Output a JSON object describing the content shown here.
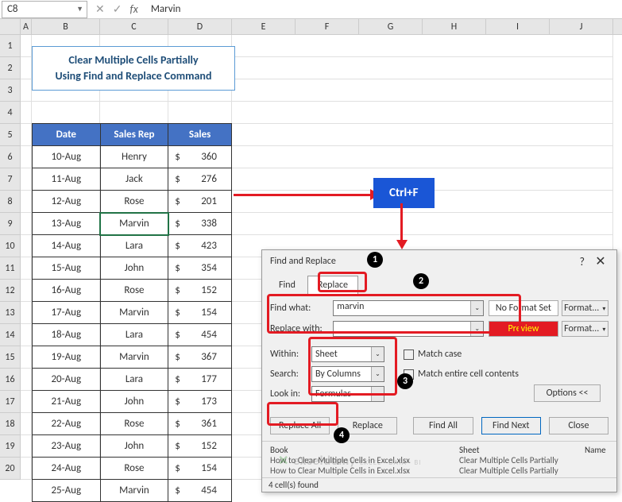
{
  "name_box": "C8",
  "formula_bar": "Marvin",
  "columns": [
    "A",
    "B",
    "C",
    "D",
    "E",
    "F",
    "G",
    "H",
    "I",
    "J"
  ],
  "rows": [
    "1",
    "2",
    "3",
    "4",
    "5",
    "6",
    "7",
    "8",
    "9",
    "10",
    "11",
    "12",
    "13",
    "14",
    "15",
    "16",
    "17",
    "18",
    "19",
    "20"
  ],
  "title_line1": "Clear Multiple Cells Partially",
  "title_line2": "Using Find and Replace Command",
  "headers": {
    "date": "Date",
    "rep": "Sales Rep",
    "sales": "Sales"
  },
  "table": [
    {
      "date": "10-Aug",
      "rep": "Henry",
      "sales": "360"
    },
    {
      "date": "11-Aug",
      "rep": "Jack",
      "sales": "276"
    },
    {
      "date": "12-Aug",
      "rep": "Rose",
      "sales": "201"
    },
    {
      "date": "13-Aug",
      "rep": "Marvin",
      "sales": "338",
      "selected": true
    },
    {
      "date": "14-Aug",
      "rep": "Lara",
      "sales": "423"
    },
    {
      "date": "15-Aug",
      "rep": "John",
      "sales": "354"
    },
    {
      "date": "16-Aug",
      "rep": "Rose",
      "sales": "152"
    },
    {
      "date": "17-Aug",
      "rep": "Marvin",
      "sales": "154"
    },
    {
      "date": "18-Aug",
      "rep": "Lara",
      "sales": "454"
    },
    {
      "date": "19-Aug",
      "rep": "Marvin",
      "sales": "367"
    },
    {
      "date": "20-Aug",
      "rep": "Lara",
      "sales": "177"
    },
    {
      "date": "21-Aug",
      "rep": "John",
      "sales": "173"
    },
    {
      "date": "22-Aug",
      "rep": "Rose",
      "sales": "361"
    },
    {
      "date": "23-Aug",
      "rep": "John",
      "sales": "152"
    },
    {
      "date": "24-Aug",
      "rep": "Rose",
      "sales": "154"
    },
    {
      "date": "25-Aug",
      "rep": "Marvin",
      "sales": "454"
    }
  ],
  "shortcut": "Ctrl+F",
  "dialog": {
    "title": "Find and Replace",
    "tab_find": "Find",
    "tab_replace": "Replace",
    "find_label": "Find what:",
    "replace_label": "Replace with:",
    "find_value": "marvin",
    "replace_value": "",
    "no_format": "No Format Set",
    "preview": "Preview",
    "format_btn": "Format...",
    "within_label": "Within:",
    "within_value": "Sheet",
    "search_label": "Search:",
    "search_value": "By Columns",
    "lookin_label": "Look in:",
    "lookin_value": "Formulas",
    "match_case": "Match case",
    "match_entire": "Match entire cell contents",
    "options_btn": "Options <<",
    "replace_all": "Replace All",
    "replace_btn": "Replace",
    "find_all": "Find All",
    "find_next": "Find Next",
    "close": "Close",
    "col_book": "Book",
    "col_sheet": "Sheet",
    "col_name": "Name",
    "result_book": "How to Clear Multiple Cells in Excel.xlsx",
    "result_sheet": "Clear Multiple Cells Partially",
    "status": "4 cell(s) found"
  },
  "watermark": "exceldemy",
  "badges": {
    "b1": "1",
    "b2": "2",
    "b3": "3",
    "b4": "4"
  }
}
